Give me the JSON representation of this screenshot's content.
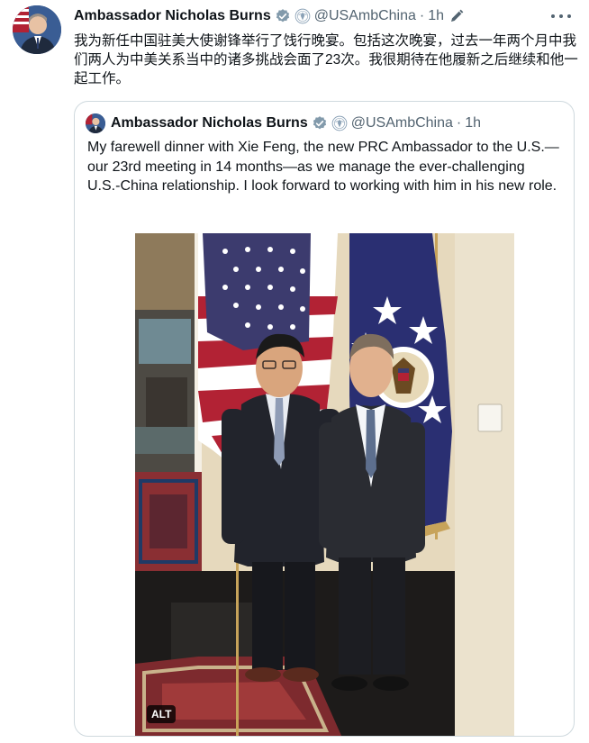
{
  "tweet": {
    "author_name": "Ambassador Nicholas Burns",
    "handle": "@USAmbChina",
    "separator": "·",
    "time": "1h",
    "text": "我为新任中国驻美大使谢锋举行了饯行晚宴。包括这次晚宴，过去一年两个月中我们两人为中美关系当中的诸多挑战会面了23次。我很期待在他履新之后继续和他一起工作。"
  },
  "quote": {
    "author_name": "Ambassador Nicholas Burns",
    "handle": "@USAmbChina",
    "separator": "·",
    "time": "1h",
    "text": "My farewell dinner with Xie Feng, the new PRC Ambassador to the U.S.—our 23rd meeting in 14 months—as we manage the ever-challenging U.S.-China relationship.  I look forward to working with him in his new role.",
    "alt_badge": "ALT"
  },
  "colors": {
    "text_primary": "#0f1419",
    "text_secondary": "#536471",
    "verified_blue": "#1d9bf0",
    "border": "#cfd9de"
  },
  "icons": [
    "verified-badge-icon",
    "government-seal-icon",
    "edit-pencil-icon",
    "more-options-icon"
  ]
}
